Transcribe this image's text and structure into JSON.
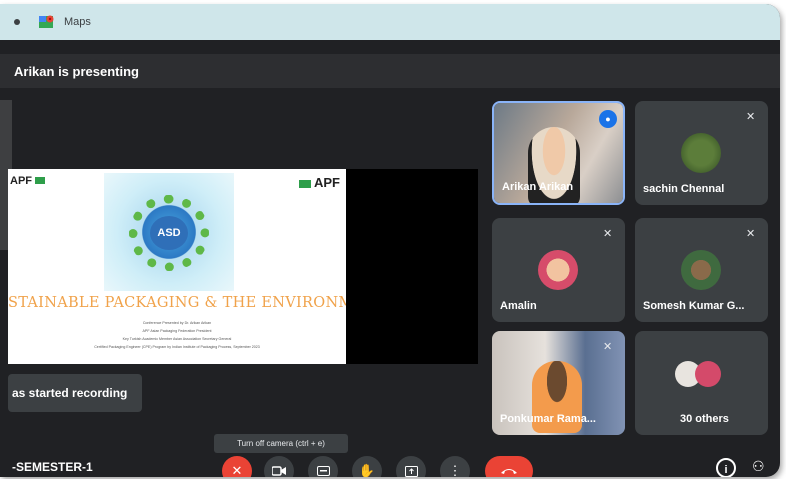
{
  "browser": {
    "tab_title": "Maps"
  },
  "meeting": {
    "presenting_label": "Arikan is presenting",
    "recording_toast": "as started recording",
    "meeting_name": "-SEMESTER-1",
    "tooltip": "Turn off camera (ctrl + e)"
  },
  "slide": {
    "logo_left": "APF",
    "logo_right": "APF",
    "globe_label": "ASD",
    "headline": "STAINABLE PACKAGING & THE ENVIRONMENT",
    "fine_print": [
      "Conference Presented by Dr. Arikan Arikan",
      "APF Asian Packaging Federation President",
      "Key Turkish Academic Member Asian Association Secretary General",
      "Certified Packaging Engineer (CPE) Program by Indian Institute of Packaging Process, September 2023"
    ]
  },
  "participants": [
    {
      "name": "Arikan Arikan",
      "speaking": true
    },
    {
      "name": "sachin Chennal",
      "muted": true
    },
    {
      "name": "Amalin",
      "muted": true
    },
    {
      "name": "Somesh Kumar G...",
      "muted": true
    },
    {
      "name": "Ponkumar Rama...",
      "muted": true
    },
    {
      "name": "30 others"
    }
  ],
  "controls": [
    "mic-off",
    "camera",
    "captions",
    "raise-hand",
    "present",
    "more",
    "end-call"
  ],
  "colors": {
    "background": "#202124",
    "tile": "#3c4043",
    "accent": "#8ab4f8",
    "end_call": "#ea4335",
    "tab_bar": "#cfe6ea"
  }
}
